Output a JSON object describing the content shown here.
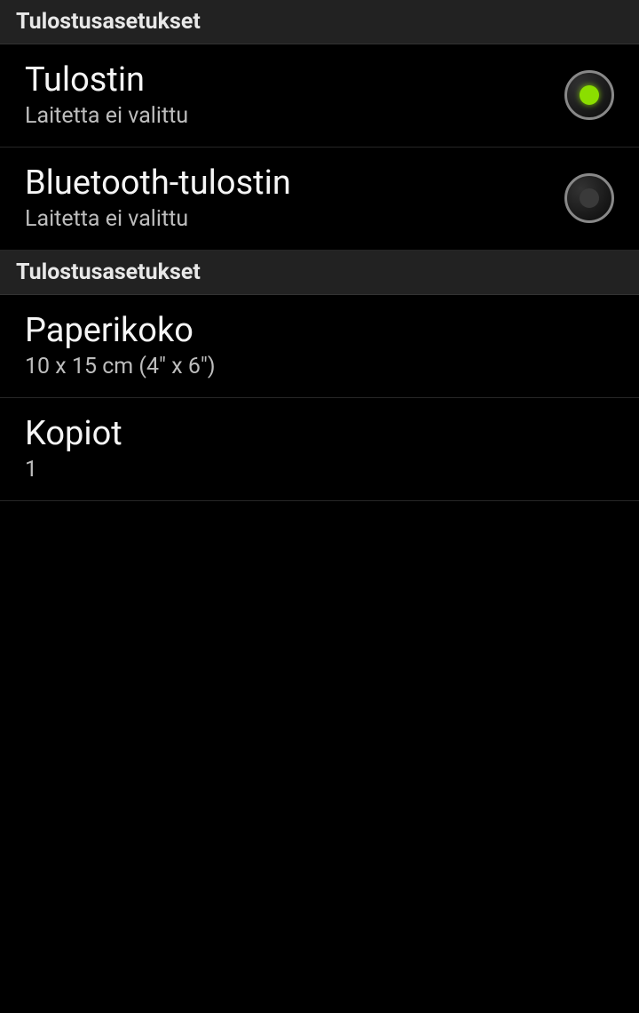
{
  "header1": {
    "title": "Tulostusasetukset"
  },
  "printer": {
    "title": "Tulostin",
    "subtitle": "Laitetta ei valittu",
    "selected": true
  },
  "bluetooth": {
    "title": "Bluetooth-tulostin",
    "subtitle": "Laitetta ei valittu",
    "selected": false
  },
  "header2": {
    "title": "Tulostusasetukset"
  },
  "papersize": {
    "title": "Paperikoko",
    "subtitle": "10 x 15 cm (4″ x 6″)"
  },
  "copies": {
    "title": "Kopiot",
    "subtitle": "1"
  }
}
